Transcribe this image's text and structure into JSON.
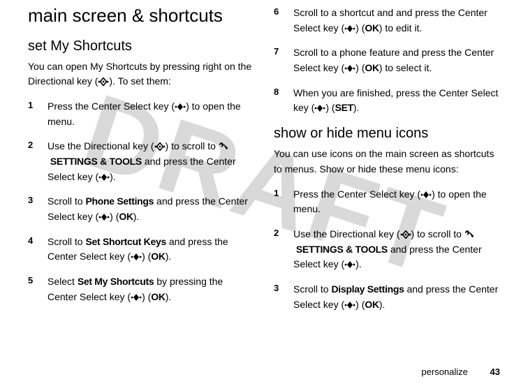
{
  "watermark": "DRAFT",
  "left": {
    "h1": "main screen & shortcuts",
    "h2": "set My Shortcuts",
    "intro_a": "You can open My Shortcuts by pressing right on the Directional key (",
    "intro_b": "). To set them:",
    "steps": [
      {
        "n": "1",
        "a": "Press the Center Select key (",
        "b": ") to open the menu."
      },
      {
        "n": "2",
        "a": "Use the Directional key (",
        "b": ") to scroll to ",
        "label": "SETTINGS & TOOLS",
        "c": " and press the Center Select key (",
        "d": ")."
      },
      {
        "n": "3",
        "a": "Scroll to ",
        "label": "Phone Settings",
        "b": " and press the Center Select key (",
        "c": ") (",
        "ok": "OK",
        "d": ")."
      },
      {
        "n": "4",
        "a": "Scroll to ",
        "label": "Set Shortcut Keys",
        "b": " and press the Center Select key (",
        "c": ") (",
        "ok": "OK",
        "d": ")."
      },
      {
        "n": "5",
        "a": "Select ",
        "label": "Set My Shortcuts",
        "b": " by pressing the Center Select key (",
        "c": ") (",
        "ok": "OK",
        "d": ")."
      }
    ]
  },
  "right": {
    "steps_top": [
      {
        "n": "6",
        "a": "Scroll to a shortcut and and press the Center Select key (",
        "b": ") (",
        "ok": "OK",
        "c": ") to edit it."
      },
      {
        "n": "7",
        "a": "Scroll to a phone feature and press the Center Select key (",
        "b": ") (",
        "ok": "OK",
        "c": ") to select it."
      },
      {
        "n": "8",
        "a": "When you are finished, press the Center Select key (",
        "b": ") (",
        "set": "SET",
        "c": ")."
      }
    ],
    "h2": "show or hide menu icons",
    "intro": "You can use icons on the main screen as shortcuts to menus. Show or hide these menu icons:",
    "steps_bottom": [
      {
        "n": "1",
        "a": "Press the Center Select key (",
        "b": ") to open the menu."
      },
      {
        "n": "2",
        "a": "Use the Directional key (",
        "b": ") to scroll to ",
        "label": "SETTINGS & TOOLS",
        "c": " and press the Center Select key (",
        "d": ")."
      },
      {
        "n": "3",
        "a": "Scroll to ",
        "label": "Display Settings",
        "b": " and press the Center Select key (",
        "c": ") (",
        "ok": "OK",
        "d": ")."
      }
    ]
  },
  "footer": {
    "section": "personalize",
    "page": "43"
  }
}
